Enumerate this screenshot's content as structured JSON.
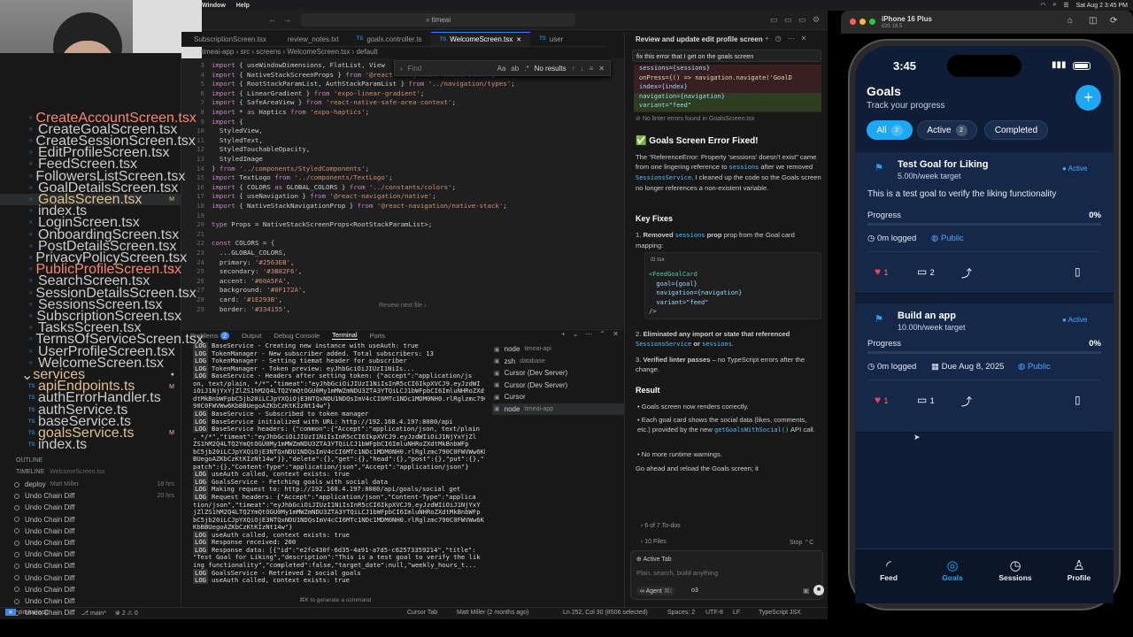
{
  "menubar": {
    "items": [
      "Window",
      "Help"
    ],
    "date_time": "Sat Aug 2  3:45 PM"
  },
  "editor": {
    "title": "timeai",
    "tabs": [
      {
        "label": "SubscriptionScreen.tsx",
        "active": false
      },
      {
        "label": "review_notes.txt",
        "active": false
      },
      {
        "label": "goals.controller.ts",
        "active": false
      },
      {
        "label": "WelcomeScreen.tsx",
        "active": true
      },
      {
        "label": "user",
        "active": false
      }
    ],
    "breadcrumb": [
      "timeai-app",
      "src",
      "screens",
      "WelcomeScreen.tsx",
      "default"
    ],
    "find": {
      "placeholder": "Find",
      "result": "No results",
      "aa": "Aa",
      "word": "ab",
      "regex": ".*"
    },
    "lines": [
      {
        "n": "",
        "t": "import { useWindowDimensions, FlatList, View"
      },
      {
        "n": "",
        "t": "import { NativeStackScreenProps } from '@react-navigation/native-stack';"
      },
      {
        "n": "",
        "t": "import { RootStackParamList, AuthStackParamList } from '../navigation/types';"
      },
      {
        "n": "",
        "t": "import { LinearGradient } from 'expo-linear-gradient';"
      },
      {
        "n": "",
        "t": "import { SafeAreaView } from 'react-native-safe-area-context';"
      },
      {
        "n": "",
        "t": "import * as Haptics from 'expo-haptics';"
      },
      {
        "n": "",
        "t": "import {"
      },
      {
        "n": "",
        "t": "  StyledView,"
      },
      {
        "n": "",
        "t": "  StyledText,"
      },
      {
        "n": "",
        "t": "  StyledTouchableOpacity,"
      },
      {
        "n": "",
        "t": "  StyledImage"
      },
      {
        "n": "",
        "t": "} from '../components/StyledComponents';"
      },
      {
        "n": "",
        "t": "import TextLogo from '../components/TextLogo';"
      },
      {
        "n": "",
        "t": "import { COLORS as GLOBAL_COLORS } from '../constants/colors';"
      },
      {
        "n": "",
        "t": "import { useNavigation } from '@react-navigation/native';"
      },
      {
        "n": "",
        "t": "import { NativeStackNavigationProp } from '@react-navigation/native-stack';"
      },
      {
        "n": "",
        "t": ""
      },
      {
        "n": "",
        "t": "type Props = NativeStackScreenProps<RootStackParamList>;"
      },
      {
        "n": "",
        "t": ""
      },
      {
        "n": "",
        "t": "const COLORS = {"
      },
      {
        "n": "",
        "t": "  ...GLOBAL_COLORS,"
      },
      {
        "n": "",
        "t": "  primary: '#2563EB',"
      },
      {
        "n": "",
        "t": "  secondary: '#3B82F6',"
      },
      {
        "n": "",
        "t": "  accent: '#60A5FA',"
      },
      {
        "n": "",
        "t": "  background: '#0F172A',"
      },
      {
        "n": "",
        "t": "  card: '#1E293B',"
      },
      {
        "n": "",
        "t": "  border: '#334155',"
      }
    ],
    "line_numbers": [
      "3",
      "4",
      "5",
      "6",
      "7",
      "8",
      "9",
      "10",
      "11",
      "12",
      "13",
      "14",
      "15",
      "16",
      "17",
      "18",
      "19",
      "20",
      "21",
      "22",
      "23",
      "24",
      "25",
      "26",
      "27",
      "28",
      "29"
    ],
    "review_next": "Review next file"
  },
  "explorer": {
    "files": [
      {
        "name": "CreateAccountScreen.tsx",
        "mark": "1",
        "color": "#f48771"
      },
      {
        "name": "CreateGoalScreen.tsx",
        "mark": "",
        "color": ""
      },
      {
        "name": "CreateSessionScreen.tsx",
        "mark": "",
        "color": ""
      },
      {
        "name": "EditProfileScreen.tsx",
        "mark": "",
        "color": ""
      },
      {
        "name": "FeedScreen.tsx",
        "mark": "",
        "color": ""
      },
      {
        "name": "FollowersListScreen.tsx",
        "mark": "",
        "color": ""
      },
      {
        "name": "GoalDetailsScreen.tsx",
        "mark": "",
        "color": ""
      },
      {
        "name": "GoalsScreen.tsx",
        "mark": "M",
        "color": "#e2c08d"
      },
      {
        "name": "index.ts",
        "mark": "",
        "color": ""
      },
      {
        "name": "LoginScreen.tsx",
        "mark": "",
        "color": ""
      },
      {
        "name": "OnboardingScreen.tsx",
        "mark": "",
        "color": ""
      },
      {
        "name": "PostDetailsScreen.tsx",
        "mark": "",
        "color": ""
      },
      {
        "name": "PrivacyPolicyScreen.tsx",
        "mark": "",
        "color": ""
      },
      {
        "name": "PublicProfileScreen.tsx",
        "mark": "1",
        "color": "#f48771"
      },
      {
        "name": "SearchScreen.tsx",
        "mark": "",
        "color": ""
      },
      {
        "name": "SessionDetailsScreen.tsx",
        "mark": "",
        "color": ""
      },
      {
        "name": "SessionsScreen.tsx",
        "mark": "",
        "color": ""
      },
      {
        "name": "SubscriptionScreen.tsx",
        "mark": "",
        "color": ""
      },
      {
        "name": "TasksScreen.tsx",
        "mark": "",
        "color": ""
      },
      {
        "name": "TermsOfServiceScreen.tsx",
        "mark": "",
        "color": ""
      },
      {
        "name": "UserProfileScreen.tsx",
        "mark": "",
        "color": ""
      },
      {
        "name": "WelcomeScreen.tsx",
        "mark": "",
        "color": ""
      }
    ],
    "services_folder": "services",
    "services": [
      {
        "name": "apiEndpoints.ts",
        "mark": "M",
        "color": "#e2c08d"
      },
      {
        "name": "authErrorHandler.ts",
        "mark": "",
        "color": ""
      },
      {
        "name": "authService.ts",
        "mark": "",
        "color": ""
      },
      {
        "name": "baseService.ts",
        "mark": "",
        "color": ""
      },
      {
        "name": "goalsService.ts",
        "mark": "M",
        "color": "#e2c08d"
      },
      {
        "name": "index.ts",
        "mark": "",
        "color": ""
      }
    ],
    "outline": "OUTLINE",
    "timeline": "TIMELINE",
    "timeline_file": "WelcomeScreen.tsx",
    "timeline_items": [
      {
        "label": "deploy",
        "author": "Matt Miller",
        "time": "18 hrs"
      },
      {
        "label": "Undo Chain Diff",
        "author": "",
        "time": "20 hrs"
      },
      {
        "label": "Undo Chain Diff",
        "author": "",
        "time": ""
      },
      {
        "label": "Undo Chain Diff",
        "author": "",
        "time": ""
      },
      {
        "label": "Undo Chain Diff",
        "author": "",
        "time": ""
      },
      {
        "label": "Undo Chain Diff",
        "author": "",
        "time": ""
      },
      {
        "label": "Undo Chain Diff",
        "author": "",
        "time": ""
      },
      {
        "label": "Undo Chain Diff",
        "author": "",
        "time": ""
      },
      {
        "label": "Undo Chain Diff",
        "author": "",
        "time": ""
      },
      {
        "label": "Undo Chain Diff",
        "author": "",
        "time": ""
      },
      {
        "label": "Undo Chain Diff",
        "author": "",
        "time": ""
      },
      {
        "label": "Undo Chain Diff",
        "author": "",
        "time": ""
      }
    ]
  },
  "panel": {
    "tabs": [
      "Problems",
      "Output",
      "Debug Console",
      "Terminal",
      "Ports"
    ],
    "problems_count": "2",
    "active_tab": "Terminal",
    "terminal_lines": [
      {
        "log": true,
        "t": "BaseService - Creating new instance with useAuth: true"
      },
      {
        "log": true,
        "t": "TokenManager - New subscriber added. Total subscribers: 13"
      },
      {
        "log": true,
        "t": "TokenManager - Setting tiemat header for subscriber"
      },
      {
        "log": true,
        "t": "TokenManager - Token preview: eyJhbGciOiJIUzI1NiIs..."
      },
      {
        "log": true,
        "t": "BaseService - Headers after setting token: {\"accept\":\"application/js"
      },
      {
        "log": false,
        "t": "on, text/plain, */*\",\"timeat\":\"eyJhbGciOiJIUzI1NiIsInR5cCI6IkpXVCJ9.eyJzdWI"
      },
      {
        "log": false,
        "t": "iOiJ1NjYxYjZlZS1hM2Q4LTQ2YmQtOGU0My1mMWZmNDU3ZTA3YTQiLCJ1bWFpbCI6ImluNHRoZXdtMkBnbW"
      },
      {
        "log": false,
        "t": "dtMkBnbWFpbC5jb20iLCJpYXQiOjE3NTQxNDU1NDQsImV4cCI6MTc1NDc1MDM0NH0.rlRglzmc790C0FWVWw6KbB"
      },
      {
        "log": false,
        "t": "90C0FWVWw6KbBBUegoAZKbCzKtKIzNt14w\"}"
      },
      {
        "log": true,
        "t": "BaseService - Subscribed to token manager"
      },
      {
        "log": true,
        "t": "BaseService initialized with URL: http://192.168.4.197:8080/api"
      },
      {
        "log": true,
        "t": "BaseService headers: {\"common\":{\"Accept\":\"application/json, text/plain"
      },
      {
        "log": false,
        "t": ", */*\",\"timeat\":\"eyJhbGciOiJIUzI1NiIsInR5cCI6IkpXVCJ9.eyJzdWIiOiJ1NjYxYjZl"
      },
      {
        "log": false,
        "t": "ZS1hM2Q4LTQ2YmQtOGU0My1mMWZmNDU3ZTA3YTQiLCJ1bWFpbCI6ImluNHRoZXdtMkBnbWFp"
      },
      {
        "log": false,
        "t": "bC5jb20iLCJpYXQiOjE3NTQxNDU1NDQsImV4cCI6MTc1NDc1MDM0NH0.rlRglzmc790C0FWVWw6KbB"
      },
      {
        "log": false,
        "t": "BUegoAZKbCzKtKIzNt14w\"}},\"delete\":{},\"get\":{},\"head\":{},\"post\":{},\"put\":{},\""
      },
      {
        "log": false,
        "t": "patch\":{},\"Content-Type\":\"application/json\",\"Accept\":\"application/json\"}"
      },
      {
        "log": true,
        "t": "useAuth called, context exists: true"
      },
      {
        "log": true,
        "t": "GoalsService - Fetching goals with social data"
      },
      {
        "log": true,
        "t": "Making request to: http://192.168.4.197:8080/api/goals/social get"
      },
      {
        "log": true,
        "t": "Request headers: {\"Accept\":\"application/json\",\"Content-Type\":\"applica"
      },
      {
        "log": false,
        "t": "tion/json\",\"timeat\":\"eyJhbGciOiJIUzI1NiIsInR5cCI6IkpXVCJ9.eyJzdWIiOiJ1NjYxY"
      },
      {
        "log": false,
        "t": "jZlZS1hM2Q4LTQ2YmQtOGU0My1mMWZmNDU3ZTA3YTQiLCJ1bWFpbCI6ImluNHRoZXdtMkBnbWFp"
      },
      {
        "log": false,
        "t": "bC5jb20iLCJpYXQiOjE3NTQxNDU1NDQsImV4cCI6MTc1NDc1MDM0NH0.rlRglzmc790C0FWVWw6K"
      },
      {
        "log": false,
        "t": "KbBBUegoAZKbCzKtKIzNt14w\"}"
      },
      {
        "log": true,
        "t": "useAuth called, context exists: true"
      },
      {
        "log": true,
        "t": "Response received: 200"
      },
      {
        "log": true,
        "t": "Response data: [{\"id\":\"e2fc430f-6d35-4a91-a7d5-c62573359214\",\"title\":"
      },
      {
        "log": false,
        "t": "\"Test Goal for Liking\",\"description\":\"This is a test goal to verify the lik"
      },
      {
        "log": false,
        "t": "ing functionality\",\"completed\":false,\"target_date\":null,\"weekly_hours_t..."
      },
      {
        "log": true,
        "t": "GoalsService - Retrieved 2 social goals"
      },
      {
        "log": true,
        "t": "useAuth called, context exists: true"
      }
    ],
    "generate_hint": "⌘K to generate a command",
    "terminals": [
      {
        "name": "node",
        "sub": "timeai-api"
      },
      {
        "name": "zsh",
        "sub": "database"
      },
      {
        "name": "Cursor (Dev Server)",
        "sub": ""
      },
      {
        "name": "Cursor (Dev Server)",
        "sub": ""
      },
      {
        "name": "Cursor",
        "sub": ""
      },
      {
        "name": "node",
        "sub": "timeai-app"
      }
    ]
  },
  "statusbar": {
    "branch": "main*",
    "errors": "2",
    "warnings": "0",
    "project": "timeai-app",
    "cursor_tab": "Cursor Tab",
    "blame": "Matt Miller (2 months ago)",
    "position": "Ln 252, Col 30 (8506 selected)",
    "spaces": "Spaces: 2",
    "encoding": "UTF-8",
    "eol": "LF",
    "language": "TypeScript JSX"
  },
  "chat": {
    "title": "Review and update edit profile screen",
    "prompt": "fix this error that I get on the goals screen",
    "diff_lines": [
      "sessions={sessions}",
      "onPress={() => navigation.navigate('GoalD",
      "index={index}",
      "navigation={navigation}",
      "variant=\"feed\""
    ],
    "linter_note": "No linter errors found in GoalsScreen.tsx",
    "heading": "✅ Goals Screen Error Fixed!",
    "para1_a": "The “ReferenceError: Property 'sessions' doesn't exist” came from one lingering reference to",
    "para1_code": "sessions",
    "para1_b": "after we removed",
    "para1_code2": "SessionsService",
    "para1_c": ". I cleaned up the code so the Goals screen no longer references a non-existent variable.",
    "key_fixes": "Key Fixes",
    "fix1_a": "Removed",
    "fix1_code": "sessions",
    "fix1_b": "prop from the Goal card mapping:",
    "code_lang": "tsx",
    "code_lines": [
      "<FeedGoalCard",
      "  goal={goal}",
      "  navigation={navigation}",
      "  variant=\"feed\"",
      "/>"
    ],
    "fix2_a": "Eliminated any import or state that referenced",
    "fix2_code": "SessionsService",
    "fix2_b": "or",
    "fix2_code2": "sessions",
    "fix3_a": "Verified linter passes",
    "fix3_b": "– no TypeScript errors after the change.",
    "result": "Result",
    "res1": "Goals screen now renders correctly.",
    "res2_a": "Each goal card shows the social data (likes, comments, etc.) provided by the new",
    "res2_code": "getGoalsWithSocial()",
    "res2_b": "API call.",
    "res3": "No more runtime warnings.",
    "closing": "Go ahead and reload the Goals screen; it",
    "todos": "6 of 7 To-dos",
    "files": "10 Files",
    "stop": "Stop",
    "active_tab": "Active Tab",
    "input_placeholder": "Plan, search, build anything",
    "agent": "Agent",
    "agent_shortcut": "⌘I",
    "model": "o3"
  },
  "simulator": {
    "device": "iPhone 16 Plus",
    "os": "iOS 18.5",
    "time": "3:45",
    "title": "Goals",
    "subtitle": "Track your progress",
    "add_button": "+",
    "filters": [
      {
        "label": "All",
        "count": "2",
        "active": true
      },
      {
        "label": "Active",
        "count": "2",
        "active": false
      },
      {
        "label": "Completed",
        "count": "",
        "active": false
      }
    ],
    "goals": [
      {
        "title": "Test Goal for Liking",
        "target": "5.00h/week target",
        "status": "Active",
        "description": "This is a test goal to verify the liking functionality",
        "progress_label": "Progress",
        "progress": "0%",
        "logged": "0m logged",
        "due": "",
        "visibility": "Public",
        "likes": "1",
        "comments": "2"
      },
      {
        "title": "Build an app",
        "target": "10.00h/week target",
        "status": "Active",
        "description": "",
        "progress_label": "Progress",
        "progress": "0%",
        "logged": "0m logged",
        "due": "Due Aug 8, 2025",
        "visibility": "Public",
        "likes": "1",
        "comments": "1"
      }
    ],
    "tabs": [
      {
        "label": "Feed",
        "active": false
      },
      {
        "label": "Goals",
        "active": true
      },
      {
        "label": "Sessions",
        "active": false
      },
      {
        "label": "Profile",
        "active": false
      }
    ]
  }
}
